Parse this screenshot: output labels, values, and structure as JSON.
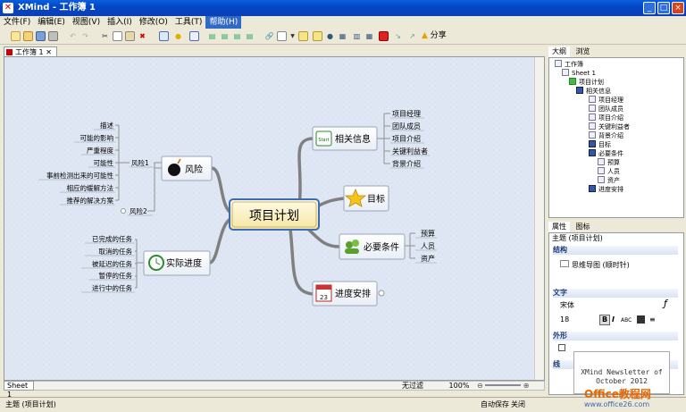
{
  "window": {
    "title": "XMind - 工作簿 1",
    "buttons": [
      "_",
      "□",
      "×"
    ]
  },
  "menu": [
    "文件(F)",
    "编辑(E)",
    "视图(V)",
    "插入(I)",
    "修改(O)",
    "工具(T)",
    "帮助(H)"
  ],
  "toolbar": {
    "share_label": "分享"
  },
  "editor": {
    "tab_label": "工作簿 1",
    "sheet_tab": "Sheet 1",
    "filter_label": "无过滤",
    "zoom": "100%"
  },
  "map": {
    "central": "项目计划",
    "branches": {
      "related": "相关信息",
      "goal": "目标",
      "conditions": "必要条件",
      "schedule": "进度安排",
      "actual": "实际进度",
      "risk": "风险"
    },
    "related_items": [
      "项目经理",
      "团队成员",
      "项目介绍",
      "关键利益者",
      "背景介绍"
    ],
    "condition_items": [
      "预算",
      "人员",
      "资产"
    ],
    "actual_items": [
      "已完成的任务",
      "取消的任务",
      "被延迟的任务",
      "暂停的任务",
      "进行中的任务"
    ],
    "risk1": "风险1",
    "risk2": "风险2",
    "risk_items": [
      "描述",
      "可能的影响",
      "严重程度",
      "可能性",
      "事前检测出来的可能性",
      "相应的缓解方法",
      "推荐的解决方案"
    ],
    "start_icon": "Start",
    "calendar_icon": "23"
  },
  "outline": {
    "tabs": [
      "大纲",
      "浏览"
    ],
    "tree": [
      "工作簿",
      "Sheet 1",
      "项目计划",
      "相关信息",
      "项目经理",
      "团队成员",
      "项目介绍",
      "关键利益者",
      "背景介绍",
      "目标",
      "必要条件",
      "预算",
      "人员",
      "资产",
      "进度安排"
    ]
  },
  "properties": {
    "tabs": [
      "属性",
      "图标"
    ],
    "subject": "主题 (项目计划)",
    "structure_header": "结构",
    "structure_value": "思维导图 (顺时针)",
    "text_header": "文字",
    "font": "宋体",
    "font_size": "18",
    "bold": "B",
    "italic": "I",
    "abc": "ABC",
    "shape_header": "外形",
    "border_header": "线",
    "newsletter_line1": "XMind Newsletter of",
    "newsletter_line2": "October 2012"
  },
  "status": {
    "left": "主题 (项目计划)",
    "autosave": "自动保存",
    "autosave_state": "关闭"
  },
  "watermark": {
    "brand": "Office教程网",
    "url": "www.office26.com"
  },
  "colors": {
    "titlebar": "#0447c6",
    "central_fill": "#fdf3c3",
    "line": "#7f7f7f"
  }
}
